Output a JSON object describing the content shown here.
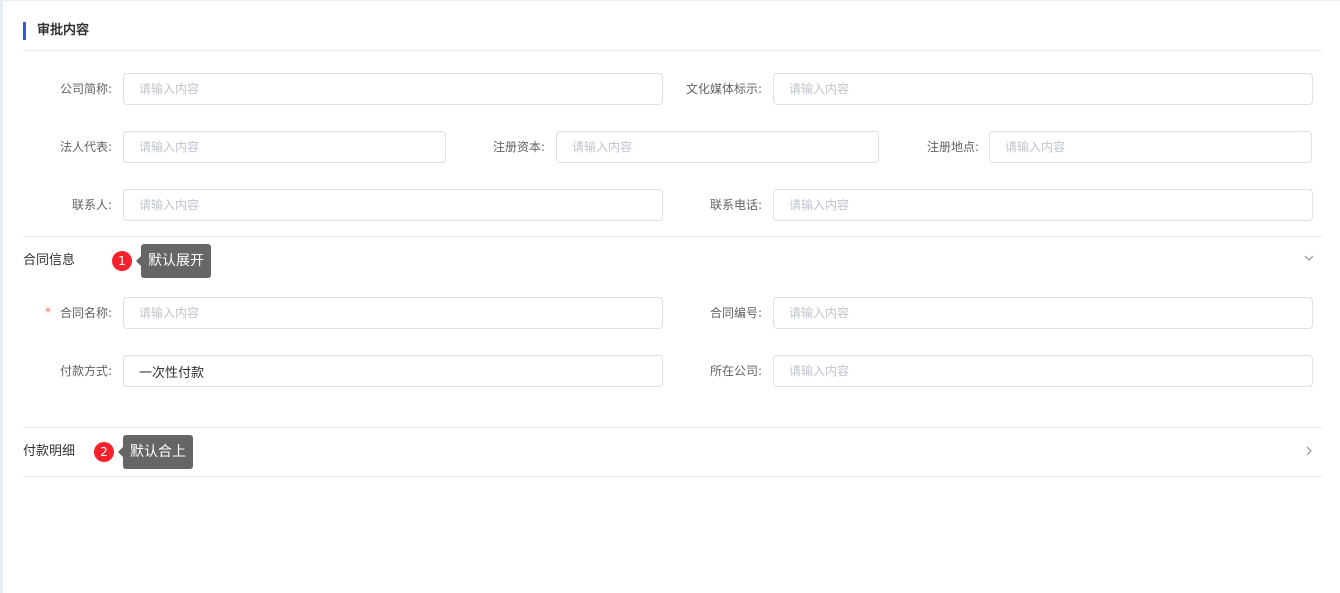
{
  "title": "审批内容",
  "placeholder": "请输入内容",
  "fields": {
    "company_short": "公司简称:",
    "media_mark": "文化媒体标示:",
    "legal_rep": "法人代表:",
    "reg_capital": "注册资本:",
    "reg_place": "注册地点:",
    "contact": "联系人:",
    "contact_phone": "联系电话:",
    "contract_name": "合同名称:",
    "contract_no": "合同编号:",
    "payment_method": "付款方式:",
    "company": "所在公司:"
  },
  "payment_method_value": "一次性付款",
  "required_mark": "*",
  "sections": [
    {
      "label": "合同信息",
      "badge": "1",
      "tip": "默认展开",
      "icon": "chevron-down-icon"
    },
    {
      "label": "付款明细",
      "badge": "2",
      "tip": "默认合上",
      "icon": "chevron-right-icon"
    }
  ]
}
